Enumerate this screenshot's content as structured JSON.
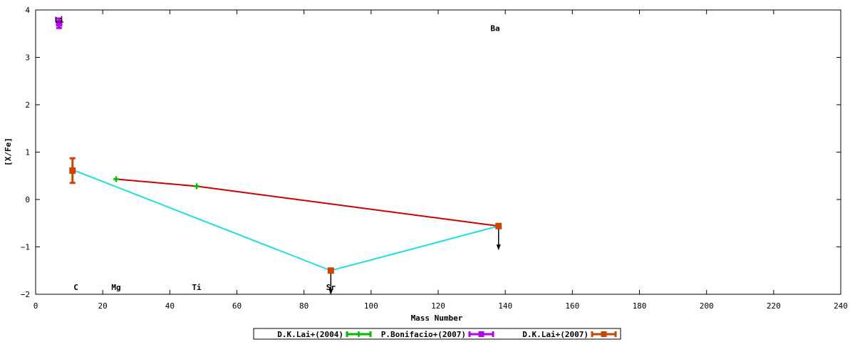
{
  "chart_data": {
    "type": "scatter",
    "title": "",
    "xlabel": "Mass Number",
    "ylabel": "[X/Fe]",
    "xlim": [
      0,
      240
    ],
    "ylim": [
      -2,
      4
    ],
    "xticks": [
      0,
      20,
      40,
      60,
      80,
      100,
      120,
      140,
      160,
      180,
      200,
      220,
      240
    ],
    "yticks": [
      -2,
      -1,
      0,
      1,
      2,
      3,
      4
    ],
    "grid": false,
    "legend_position": "bottom-center",
    "element_labels": [
      {
        "text": "Li",
        "x": 7,
        "y": 3.8
      },
      {
        "text": "C",
        "x": 12,
        "y": -1.85
      },
      {
        "text": "Mg",
        "x": 24,
        "y": -1.85
      },
      {
        "text": "Ti",
        "x": 48,
        "y": -1.85
      },
      {
        "text": "Sr",
        "x": 88,
        "y": -1.85
      },
      {
        "text": "Ba",
        "x": 137,
        "y": 3.62
      }
    ],
    "series": [
      {
        "name": "D.K.Lai+(2004)",
        "color": "#cc0000",
        "marker": "none",
        "points": [
          {
            "x": 24,
            "y": 0.43
          },
          {
            "x": 48,
            "y": 0.28
          },
          {
            "x": 138,
            "y": -0.56
          }
        ]
      },
      {
        "name": "P.Bonifacio+(2007)",
        "color": "#00bb00",
        "marker": "plus",
        "points": [
          {
            "x": 24,
            "y": 0.43
          },
          {
            "x": 48,
            "y": 0.28
          }
        ]
      },
      {
        "name": "",
        "color": "#bb00ee",
        "marker": "square",
        "points": [
          {
            "x": 7,
            "y": 3.72,
            "yerr": 0.1
          }
        ]
      },
      {
        "name": "D.K.Lai+(2007)",
        "color": "#cc4400",
        "marker": "square",
        "points": [
          {
            "x": 11,
            "y": 0.61,
            "yerr": 0.26
          },
          {
            "x": 88,
            "y": -1.5,
            "upper_limit": true
          },
          {
            "x": 138,
            "y": -0.56,
            "upper_limit": true
          }
        ]
      },
      {
        "name": "",
        "color": "#22dddd",
        "marker": "none",
        "points": [
          {
            "x": 12,
            "y": 0.6
          },
          {
            "x": 88,
            "y": -1.5
          },
          {
            "x": 138,
            "y": -0.56
          }
        ]
      }
    ],
    "legend": [
      {
        "label": "D.K.Lai+(2004)",
        "color": "#00bb00",
        "marker": "plus"
      },
      {
        "label": "P.Bonifacio+(2007)",
        "color": "#bb00ee",
        "marker": "square"
      },
      {
        "label": "D.K.Lai+(2007)",
        "color": "#cc4400",
        "marker": "square"
      }
    ]
  }
}
